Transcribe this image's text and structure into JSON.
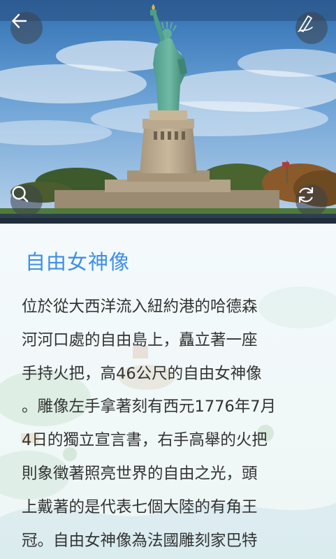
{
  "header": {
    "back_icon": "arrow-left-icon",
    "edit_icon": "pen-edit-icon",
    "search_icon": "search-icon",
    "rotate_icon": "refresh-icon"
  },
  "article": {
    "title": "自由女神像",
    "lines": [
      "位於從大西洋流入紐約港的哈德森",
      "河河口處的自由島上，矗立著一座",
      "手持火把，高46公尺的自由女神像",
      "。雕像左手拿著刻有西元1776年7月",
      "4日的獨立宣言書，右手高舉的火把",
      "則象徵著照亮世界的自由之光，頭",
      "上戴著的是代表七個大陸的有角王",
      "冠。自由女神像為法國雕刻家巴特"
    ]
  },
  "colors": {
    "title": "#3d8fe6",
    "text": "#333333",
    "button_bg": "rgba(60,66,74,0.55)"
  }
}
